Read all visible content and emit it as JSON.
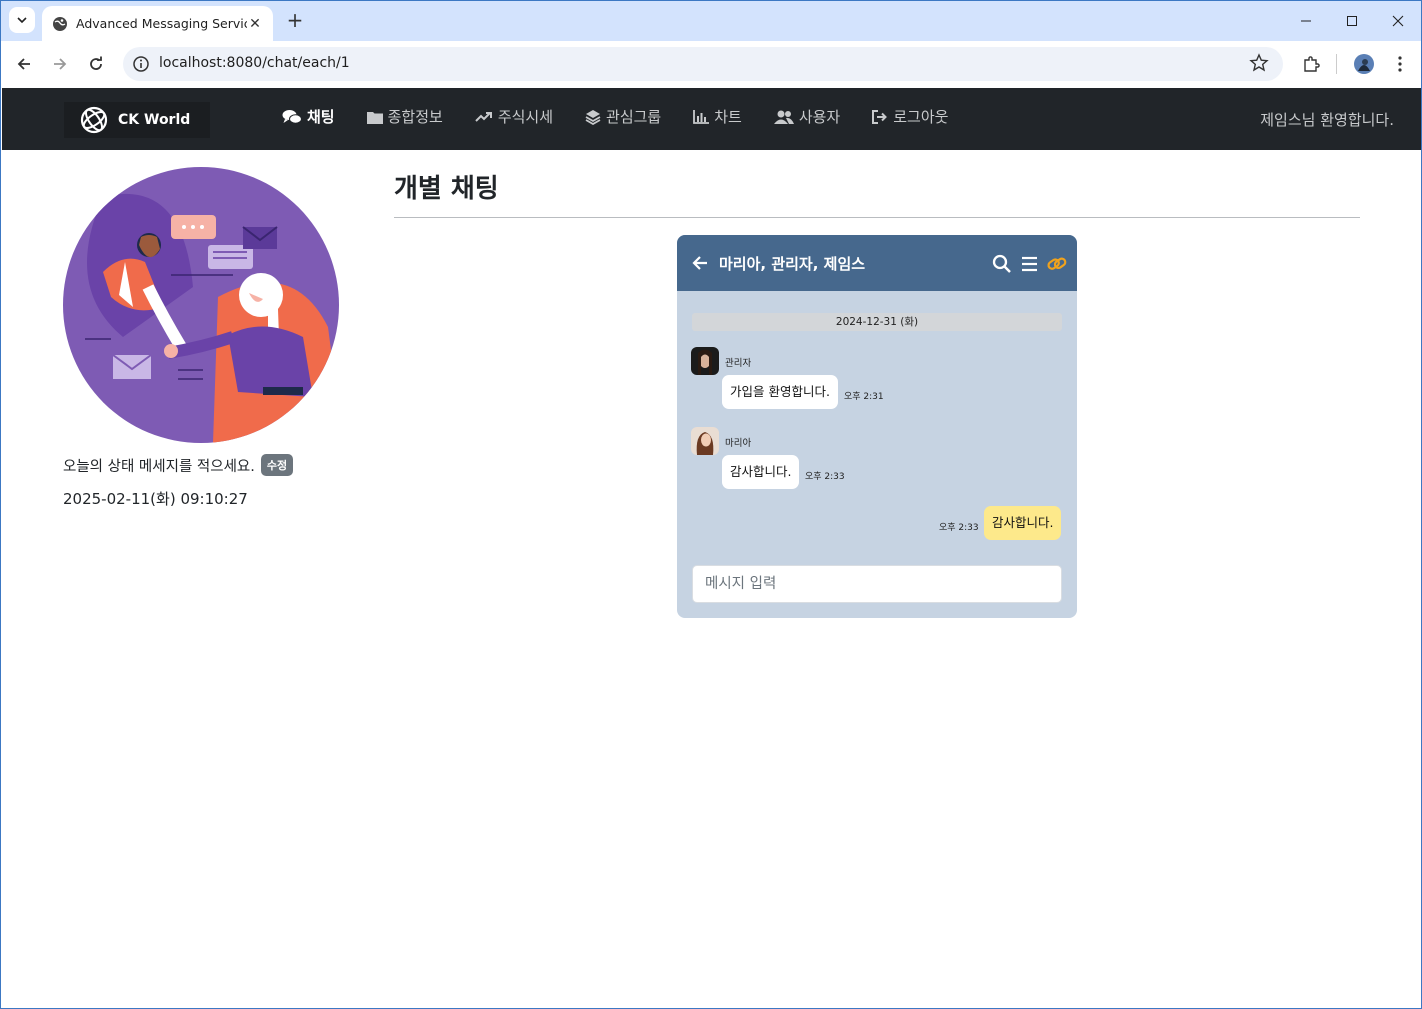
{
  "browser": {
    "tab_title": "Advanced Messaging Service",
    "url": "localhost:8080/chat/each/1"
  },
  "app": {
    "brand": "CK World",
    "menu": [
      {
        "label": "채팅",
        "icon": "chat-icon",
        "active": true
      },
      {
        "label": "종합정보",
        "icon": "folder-icon",
        "active": false
      },
      {
        "label": "주식시세",
        "icon": "trend-icon",
        "active": false
      },
      {
        "label": "관심그룹",
        "icon": "layers-icon",
        "active": false
      },
      {
        "label": "차트",
        "icon": "bar-chart-icon",
        "active": false
      },
      {
        "label": "사용자",
        "icon": "users-icon",
        "active": false
      },
      {
        "label": "로그아웃",
        "icon": "logout-icon",
        "active": false
      }
    ],
    "welcome": "제임스님 환영합니다."
  },
  "sidebar": {
    "status_message": "오늘의 상태 메세지를 적으세요.",
    "edit_label": "수정",
    "datetime": "2025-02-11(화) 09:10:27"
  },
  "main": {
    "title": "개별 채팅",
    "chat": {
      "room_title": "마리아, 관리자, 제임스",
      "date": "2024-12-31 (화)",
      "messages": [
        {
          "sender": "관리자",
          "text": "가입을 환영합니다.",
          "time": "오후 2:31",
          "mine": false
        },
        {
          "sender": "마리아",
          "text": "감사합니다.",
          "time": "오후 2:33",
          "mine": false
        },
        {
          "sender": "",
          "text": "감사합니다.",
          "time": "오후 2:33",
          "mine": true
        }
      ],
      "input_placeholder": "메시지 입력"
    }
  },
  "colors": {
    "navbar": "#212529",
    "chat_header": "#46688d",
    "chat_bg": "#c6d3e2",
    "my_bubble": "#fde98b",
    "link_icon": "#f0a21c"
  }
}
